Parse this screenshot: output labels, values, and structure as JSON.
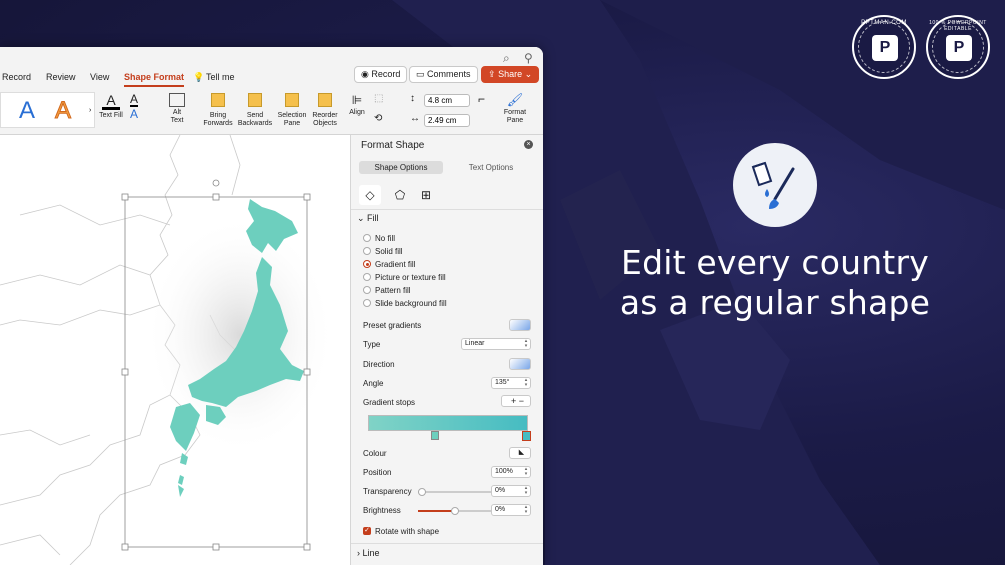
{
  "window": {
    "menu_tabs": [
      "Record",
      "Review",
      "View",
      "Shape Format"
    ],
    "tell_me": "Tell me",
    "record_button": "Record",
    "comments_button": "Comments",
    "share_button": "Share"
  },
  "ribbon": {
    "text_fill": "Text Fill",
    "alt_text": "Alt\nText",
    "bring_forwards": "Bring\nForwards",
    "send_backwards": "Send\nBackwards",
    "selection_pane": "Selection\nPane",
    "reorder_objects": "Reorder\nObjects",
    "align": "Align",
    "height_value": "4.8 cm",
    "width_value": "2.49 cm",
    "format_pane": "Format\nPane",
    "wordart_letter": "A"
  },
  "pane": {
    "title": "Format Shape",
    "tab_shape_options": "Shape Options",
    "tab_text_options": "Text Options",
    "fill_section": "Fill",
    "fill_options": [
      "No fill",
      "Solid fill",
      "Gradient fill",
      "Picture or texture fill",
      "Pattern fill",
      "Slide background fill"
    ],
    "selected_fill": "Gradient fill",
    "preset_gradients_label": "Preset gradients",
    "type_label": "Type",
    "type_value": "Linear",
    "direction_label": "Direction",
    "angle_label": "Angle",
    "angle_value": "135°",
    "gradient_stops_label": "Gradient stops",
    "colour_label": "Colour",
    "position_label": "Position",
    "position_value": "100%",
    "transparency_label": "Transparency",
    "transparency_value": "0%",
    "brightness_label": "Brightness",
    "brightness_value": "0%",
    "rotate_label": "Rotate with shape",
    "line_section": "Line"
  },
  "promo": {
    "headline_line1": "Edit every country",
    "headline_line2": "as a regular shape",
    "badge1_text": "PPTMAN.COM",
    "badge2_text": "100 % POWERPOINT EDITABLE"
  },
  "colors": {
    "accent": "#c43e1c",
    "japan_fill": "#6dcfbe",
    "gradient_start": "#80d3c6",
    "gradient_end": "#46bcc2",
    "background": "#1b1b47"
  }
}
